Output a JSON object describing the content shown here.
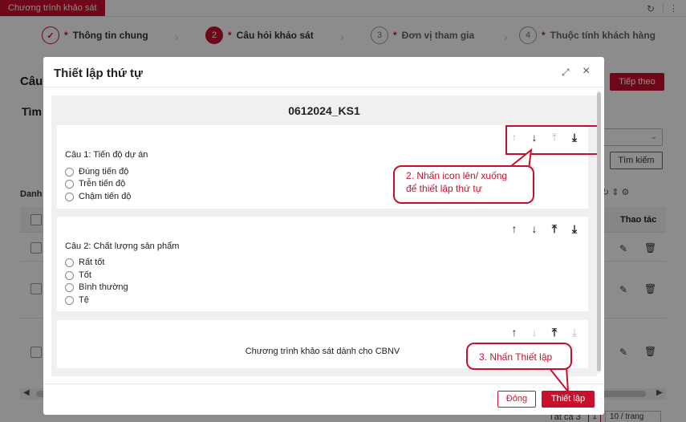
{
  "app": {
    "tab_label": "Chương trình khảo sát"
  },
  "steps": [
    {
      "number": "1",
      "label": "Thông tin chung",
      "state": "done"
    },
    {
      "number": "2",
      "label": "Câu hỏi khảo sát",
      "state": "active"
    },
    {
      "number": "3",
      "label": "Đơn vị tham gia",
      "state": "pending"
    },
    {
      "number": "4",
      "label": "Thuộc tính khách hàng",
      "state": "pending"
    }
  ],
  "background": {
    "title_partial": "Câu",
    "next_button": "Tiếp theo",
    "search_partial": "Tìm",
    "search_button": "Tìm kiếm",
    "list_partial": "Danh",
    "actions_header": "Thao tác",
    "pager_total": "Tất cả 3",
    "pager_page": "1",
    "pager_size": "10 / trang"
  },
  "modal": {
    "title": "Thiết lập thứ tự",
    "survey_name": "0612024_KS1",
    "questions": [
      {
        "title": "Câu 1: Tiến độ dự án",
        "options": [
          "Đúng tiến độ",
          "Trễn tiến độ",
          "Chậm tiến độ"
        ]
      },
      {
        "title": "Câu 2: Chất lượng sản phẩm",
        "options": [
          "Rất tốt",
          "Tốt",
          "Bình thường",
          "Tệ"
        ]
      }
    ],
    "end_text": "Chương trình khảo sát dành cho CBNV",
    "close_button": "Đóng",
    "setup_button": "Thiết lập"
  },
  "callouts": {
    "reorder_hint_line1": "2. Nhấn icon lên/ xuống",
    "reorder_hint_line2": "để thiết lập thứ tự",
    "setup_hint": "3. Nhấn Thiết lập"
  },
  "icons": {
    "move_up": "↑",
    "move_down": "↓",
    "move_top": "⤒",
    "move_bottom": "⤓"
  },
  "colors": {
    "accent": "#c8102e"
  }
}
